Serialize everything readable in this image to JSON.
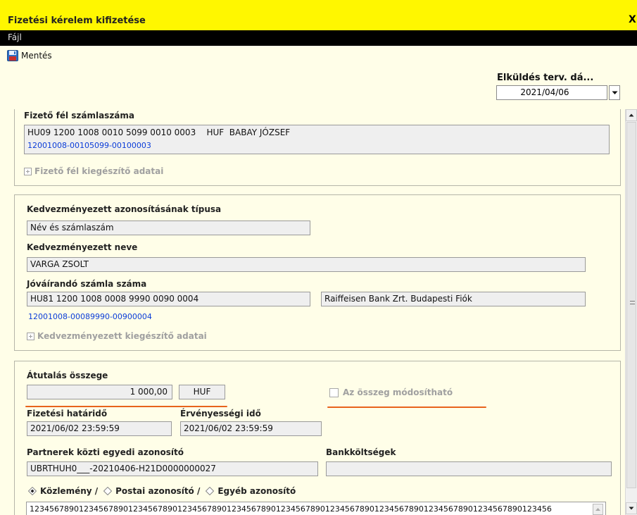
{
  "window": {
    "title": "Fizetési kérelem kifizetése",
    "close_label": "X"
  },
  "menu": {
    "file": "Fájl"
  },
  "toolbar": {
    "save_label": "Mentés"
  },
  "header": {
    "send_label": "Elküldés terv. dá...",
    "send_date": "2021/04/06"
  },
  "payer": {
    "label": "Fizető fél számlaszáma",
    "account_line": "HU09 1200 1008 0010 5099 0010 0003    HUF  BABAY JÓZSEF",
    "account_short": "12001008-00105099-00100003",
    "expander_label": "Fizető fél kiegészítő adatai"
  },
  "beneficiary": {
    "id_type_label": "Kedvezményezett azonosításának típusa",
    "id_type_value": "Név és számlaszám",
    "name_label": "Kedvezményezett neve",
    "name_value": "VARGA ZSOLT",
    "account_label": "Jóváírandó számla száma",
    "account_value": "HU81 1200 1008 0008 9990 0090 0004",
    "bank_value": "Raiffeisen Bank Zrt. Budapesti Fiók",
    "account_short": "12001008-00089990-00900004",
    "expander_label": "Kedvezményezett kiegészítő adatai"
  },
  "transfer": {
    "amount_label": "Átutalás összege",
    "amount_value": "1 000,00",
    "currency": "HUF",
    "modifiable_label": "Az összeg módosítható",
    "modifiable_checked": false,
    "deadline_label": "Fizetési határidő",
    "deadline_value": "2021/06/02 23:59:59",
    "validity_label": "Érvényességi idő",
    "validity_value": "2021/06/02 23:59:59",
    "partner_id_label": "Partnerek közti egyedi azonosító",
    "partner_id_value": "UBRTHUH0___-20210406-H21D0000000027",
    "bank_costs_label": "Bankköltségek",
    "bank_costs_value": "",
    "radio_options": [
      "Közlemény /",
      "Postai azonosító /",
      "Egyéb azonosító"
    ],
    "radio_selected": "Közlemény /",
    "remittance_value": "1234567890123456789012345678901234567890123456789012345678901234567890123456789012345678901234567890123456"
  },
  "colors": {
    "title_bar": "#fff700",
    "menu_bar": "#000000",
    "panel_bg": "#fffee8",
    "link": "#0a3cd8",
    "annotation": "#e8631c"
  },
  "icons": {
    "save": "floppy-disk-icon",
    "dropdown": "chevron-down-icon",
    "expander": "plus-box-icon"
  }
}
